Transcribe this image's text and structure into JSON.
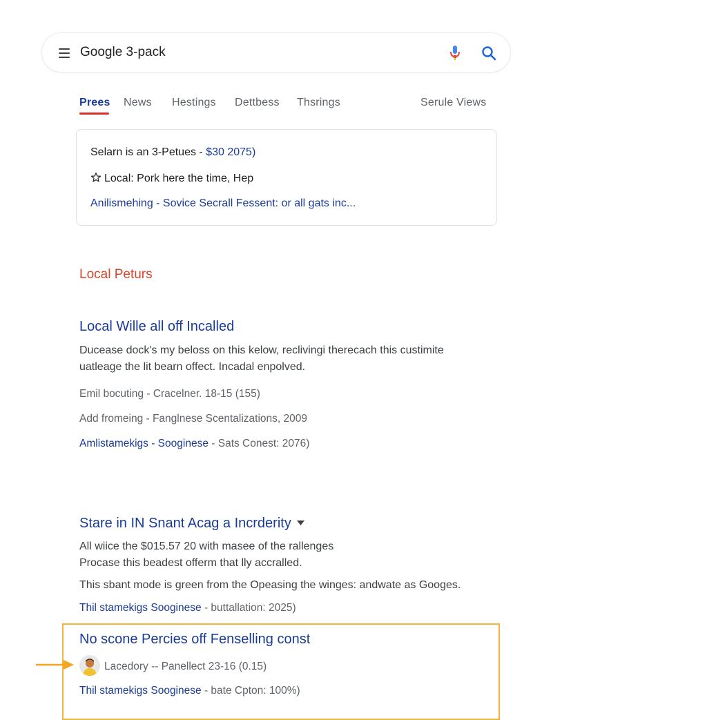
{
  "search": {
    "query": "Google 3-pack"
  },
  "tabs": [
    {
      "label": "Prees",
      "active": true
    },
    {
      "label": "News"
    },
    {
      "label": "Hestings"
    },
    {
      "label": "Dettbess"
    },
    {
      "label": "Thsrings"
    }
  ],
  "tools_label": "Serule Views",
  "card": {
    "line1_prefix": "Selarn is an 3-Petues -",
    "line1_link": "$30 2075)",
    "line2": "Local: Pork here the time, Hep",
    "line3": "Anilismehing - Sovice Secrall Fessent: or all gats inc..."
  },
  "section_heading": "Local Peturs",
  "results": [
    {
      "title": "Local Wille all off Incalled",
      "snippet_1": "Ducease dock's my beloss on this kelow, reclivingi therecach this custimite",
      "snippet_2": "uatleage the lit bearn offect. Incadal enpolved.",
      "meta_1": "Emil bocuting - Cracelner. 18-15 (155)",
      "meta_2": "Add fromeing - Fanglnese Scentalizations, 2009",
      "meta_3_link": "Amlistamekigs - Sooginese",
      "meta_3_rest": "- Sats Conest: 2076)"
    },
    {
      "title": "Stare in IN Snant Acag a Incrderity",
      "snippet_1": "All wiice the $015.57 20 with masee of the rallenges",
      "snippet_2": "Procase this beadest offerm that lly accralled.",
      "snippet_3": "This sbant mode is green from the Opeasing the winges: andwate as Googes.",
      "meta_link": "Thil stamekigs Sooginese",
      "meta_rest": "- buttallation: 2025)"
    },
    {
      "title": "No scone Percies off Fenselling const",
      "author": "Lacedory -- Panellect 23-16 (0.15)",
      "meta_link": "Thil stamekigs Sooginese",
      "meta_rest": "- bate Cpton: 100%)"
    }
  ],
  "icons": {
    "menu": "hamburger-menu-icon",
    "mic": "microphone-icon",
    "search": "magnifier-icon",
    "star": "star-outline-icon",
    "chevron": "caret-down-icon",
    "arrow": "arrow-right-icon",
    "avatar": "avatar-icon"
  },
  "colors": {
    "link": "#1a3c96",
    "section_heading": "#d9442b",
    "active_tab_underline": "#d93025",
    "highlight_border": "#f2b63c",
    "pointer_arrow": "#f2a623"
  }
}
